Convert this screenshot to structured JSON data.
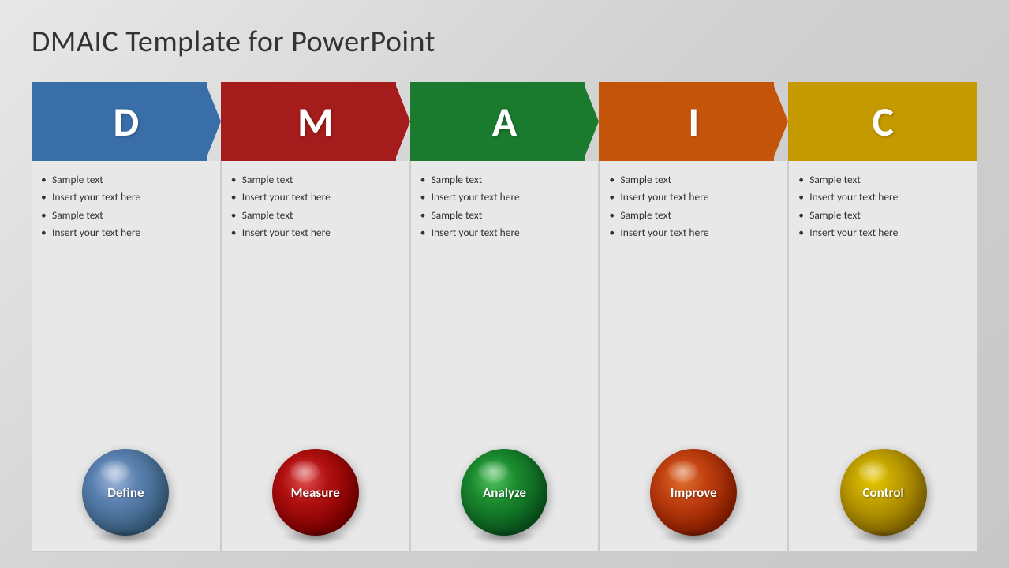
{
  "title": "DMAIC Template for PowerPoint",
  "columns": [
    {
      "id": "d",
      "letter": "D",
      "color": "#3a6ea8",
      "ball_label": "Define",
      "ball_class": "ball-define",
      "col_class": "col-d",
      "bullets": [
        "Sample text",
        "Insert your text here",
        "Sample text",
        "Insert your text here"
      ]
    },
    {
      "id": "m",
      "letter": "M",
      "color": "#a51c1c",
      "ball_label": "Measure",
      "ball_class": "ball-measure",
      "col_class": "col-m",
      "bullets": [
        "Sample text",
        "Insert your text here",
        "Sample text",
        "Insert your text here"
      ]
    },
    {
      "id": "a",
      "letter": "A",
      "color": "#1a7a2e",
      "ball_label": "Analyze",
      "ball_class": "ball-analyze",
      "col_class": "col-a",
      "bullets": [
        "Sample text",
        "Insert your text here",
        "Sample text",
        "Insert your text here"
      ]
    },
    {
      "id": "i",
      "letter": "I",
      "color": "#c4540a",
      "ball_label": "Improve",
      "ball_class": "ball-improve",
      "col_class": "col-i",
      "bullets": [
        "Sample text",
        "Insert your text here",
        "Sample text",
        "Insert your text here"
      ]
    },
    {
      "id": "c",
      "letter": "C",
      "color": "#c49a00",
      "ball_label": "Control",
      "ball_class": "ball-control",
      "col_class": "col-c",
      "bullets": [
        "Sample text",
        "Insert your text here",
        "Sample text",
        "Insert your text here"
      ]
    }
  ]
}
